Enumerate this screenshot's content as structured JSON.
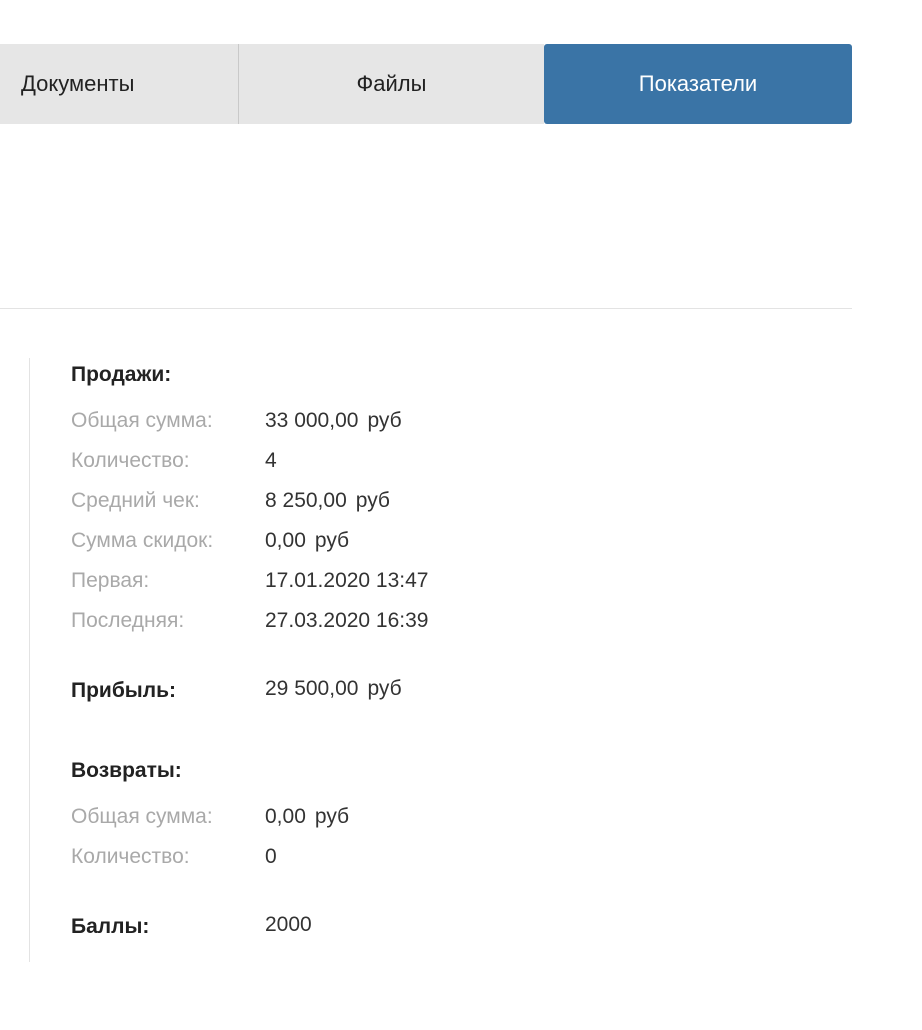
{
  "tabs": {
    "documents": "Документы",
    "files": "Файлы",
    "indicators": "Показатели"
  },
  "sales": {
    "title": "Продажи:",
    "total_label": "Общая сумма:",
    "total_value": "33 000,00",
    "total_unit": "руб",
    "count_label": "Количество:",
    "count_value": "4",
    "avg_label": "Средний чек:",
    "avg_value": "8 250,00",
    "avg_unit": "руб",
    "discount_label": "Сумма скидок:",
    "discount_value": "0,00",
    "discount_unit": "руб",
    "first_label": "Первая:",
    "first_value": "17.01.2020 13:47",
    "last_label": "Последняя:",
    "last_value": "27.03.2020 16:39"
  },
  "profit": {
    "title": "Прибыль:",
    "value": "29 500,00",
    "unit": "руб"
  },
  "returns": {
    "title": "Возвраты:",
    "total_label": "Общая сумма:",
    "total_value": "0,00",
    "total_unit": "руб",
    "count_label": "Количество:",
    "count_value": "0"
  },
  "points": {
    "title": "Баллы:",
    "value": "2000"
  }
}
